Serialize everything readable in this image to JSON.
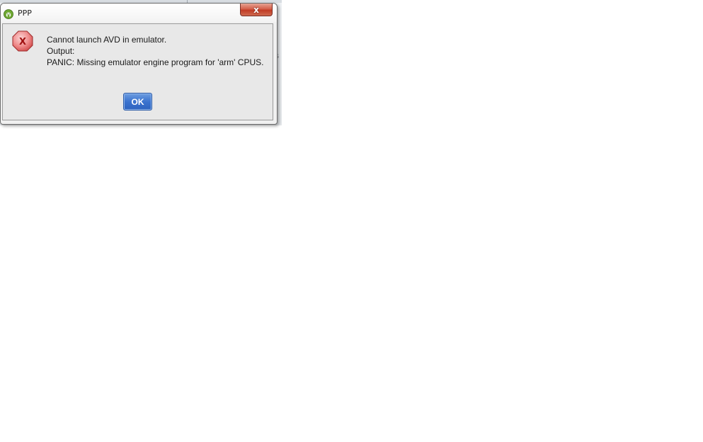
{
  "dialog": {
    "title": "PPP",
    "close_icon_name": "close-icon",
    "close_glyph": "x",
    "app_icon_name": "android-app-icon",
    "error_icon_name": "error-stop-icon",
    "error_glyph": "X",
    "message_lines": [
      "Cannot launch AVD in emulator.",
      "Output:",
      "PANIC: Missing emulator engine program for 'arm' CPUS."
    ],
    "ok_label": "OK"
  },
  "colors": {
    "ok_button": "#3b73cf",
    "close_button": "#c13c25",
    "error_icon": "#e05a5a"
  }
}
